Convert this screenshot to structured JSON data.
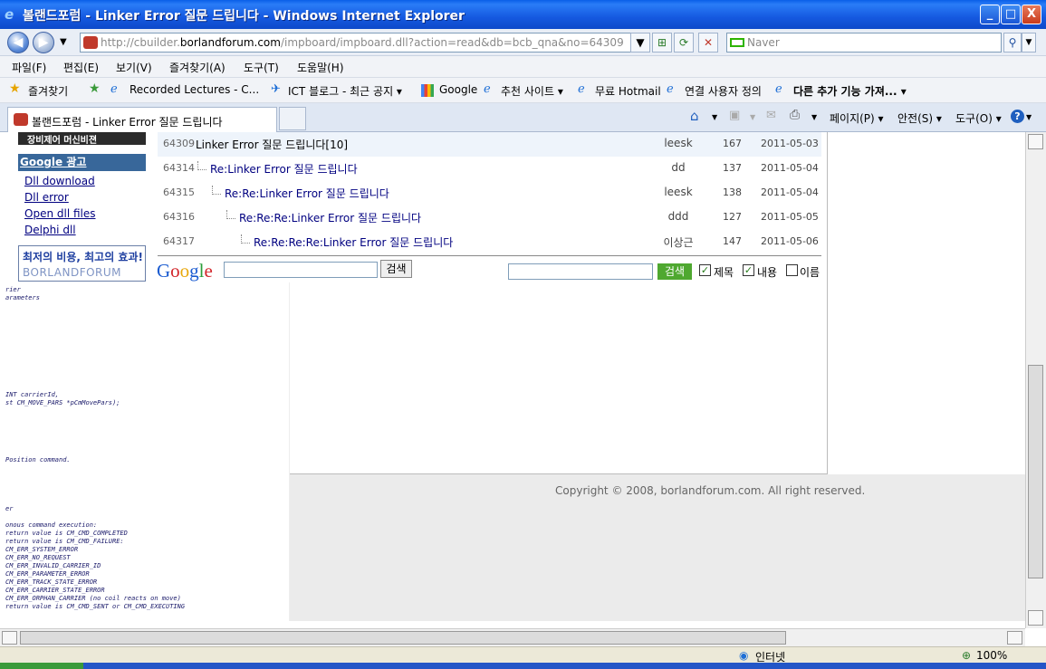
{
  "window": {
    "title": "볼랜드포럼 - Linker Error 질문 드립니다 - Windows Internet Explorer",
    "min_label": "_",
    "max_label": "□",
    "close_label": "X"
  },
  "address": {
    "url_prefix": "http://cbuilder.",
    "url_domain": "borlandforum.com",
    "url_suffix": "/impboard/impboard.dll?action=read&db=bcb_qna&no=64309",
    "search_placeholder": "Naver"
  },
  "menu": [
    "파일(F)",
    "편집(E)",
    "보기(V)",
    "즐겨찾기(A)",
    "도구(T)",
    "도움말(H)"
  ],
  "favorites": {
    "label": "즐겨찾기",
    "items": [
      "Recorded Lectures - C...",
      "ICT 블로그 - 최근 공지 ▾",
      "Google",
      "추천 사이트 ▾",
      "무료 Hotmail",
      "연결 사용자 정의",
      "다른 추가 기능 가져... ▾"
    ]
  },
  "tab": {
    "title": "볼랜드포럼 - Linker Error 질문 드립니다",
    "commands": [
      "페이지(P) ▾",
      "안전(S) ▾",
      "도구(O) ▾"
    ]
  },
  "sidebar": {
    "banner_top": "장비제어  머신비젼",
    "ad_heading": "Google 광고",
    "ad_links": [
      "Dll download",
      "Dll error",
      "Open dll files",
      "Delphi dll"
    ],
    "banner_slogan": "최저의 비용, 최고의 효과!",
    "banner_brand": "BORLANDFORUM"
  },
  "threads": [
    {
      "no": "64309",
      "subject": "Linker Error 질문 드립니다[10]",
      "author": "leesk",
      "hits": "167",
      "date": "2011-05-03",
      "depth": 0
    },
    {
      "no": "64314",
      "subject": "Re:Linker Error 질문 드립니다",
      "author": "dd",
      "hits": "137",
      "date": "2011-05-04",
      "depth": 1
    },
    {
      "no": "64315",
      "subject": "Re:Re:Linker Error 질문 드립니다",
      "author": "leesk",
      "hits": "138",
      "date": "2011-05-04",
      "depth": 2
    },
    {
      "no": "64316",
      "subject": "Re:Re:Re:Linker Error 질문 드립니다",
      "author": "ddd",
      "hits": "127",
      "date": "2011-05-05",
      "depth": 3
    },
    {
      "no": "64317",
      "subject": "Re:Re:Re:Re:Linker Error 질문 드립니다",
      "author": "이상근",
      "hits": "147",
      "date": "2011-05-06",
      "depth": 4
    }
  ],
  "search": {
    "google_logo": "Google",
    "google_button": "검색",
    "board_button": "검색",
    "options": [
      {
        "label": "제목",
        "checked": true
      },
      {
        "label": "내용",
        "checked": true
      },
      {
        "label": "이름",
        "checked": false
      }
    ]
  },
  "code_lines": [
    "rier",
    "arameters",
    "INT             carrierId,",
    "st CM_MOVE_PARS *pCmMovePars);",
    "Position command.",
    "er",
    "onous command execution:",
    " return value is CM_CMD_COMPLETED",
    " return value is CM_CMD_FAILURE:",
    "CM_ERR_SYSTEM_ERROR",
    "CM_ERR_NO_REQUEST",
    "CM_ERR_INVALID_CARRIER_ID",
    "CM_ERR_PARAMETER_ERROR",
    "CM_ERR_TRACK_STATE_ERROR",
    "CM_ERR_CARRIER_STATE_ERROR",
    "CM_ERR_ORPHAN_CARRIER (no coil reacts on move)",
    " return value is CM_CMD_SENT or CM_CMD_EXECUTING"
  ],
  "copyright": "Copyright © 2008, borlandforum.com. All right reserved.",
  "status": {
    "zone": "인터넷",
    "zoom": "100%"
  }
}
